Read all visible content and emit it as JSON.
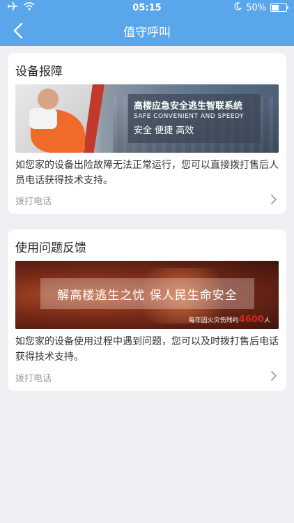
{
  "status_bar": {
    "time": "05:15",
    "battery": "50%",
    "battery_level": 0.5
  },
  "nav": {
    "title": "值守呼叫"
  },
  "cards": [
    {
      "title": "设备报障",
      "banner": {
        "headline": "高楼应急安全逃生智联系统",
        "subline": "SAFE CONVENIENT AND SPEEDY",
        "tagline": "安全  便捷  高效"
      },
      "description": "如您家的设备出险故障无法正常运行，您可以直接拨打售后人员电话获得技术支持。",
      "action_label": "拨打电话"
    },
    {
      "title": "使用问题反馈",
      "banner": {
        "headline": "解高楼逃生之忧  保人民生命安全",
        "stat_prefix": "每年因火灾伤残约",
        "stat_number": "4600",
        "stat_suffix": "人"
      },
      "description": "如您家的设备使用过程中遇到问题，您可以及时拨打售后电话获得技术支持。",
      "action_label": "拨打电话"
    }
  ],
  "colors": {
    "accent": "#5aa6ea",
    "background": "#efeff4"
  },
  "icons": [
    "airplane-icon",
    "wifi-icon",
    "moon-icon",
    "battery-icon",
    "back-arrow-icon",
    "chevron-right-icon"
  ]
}
